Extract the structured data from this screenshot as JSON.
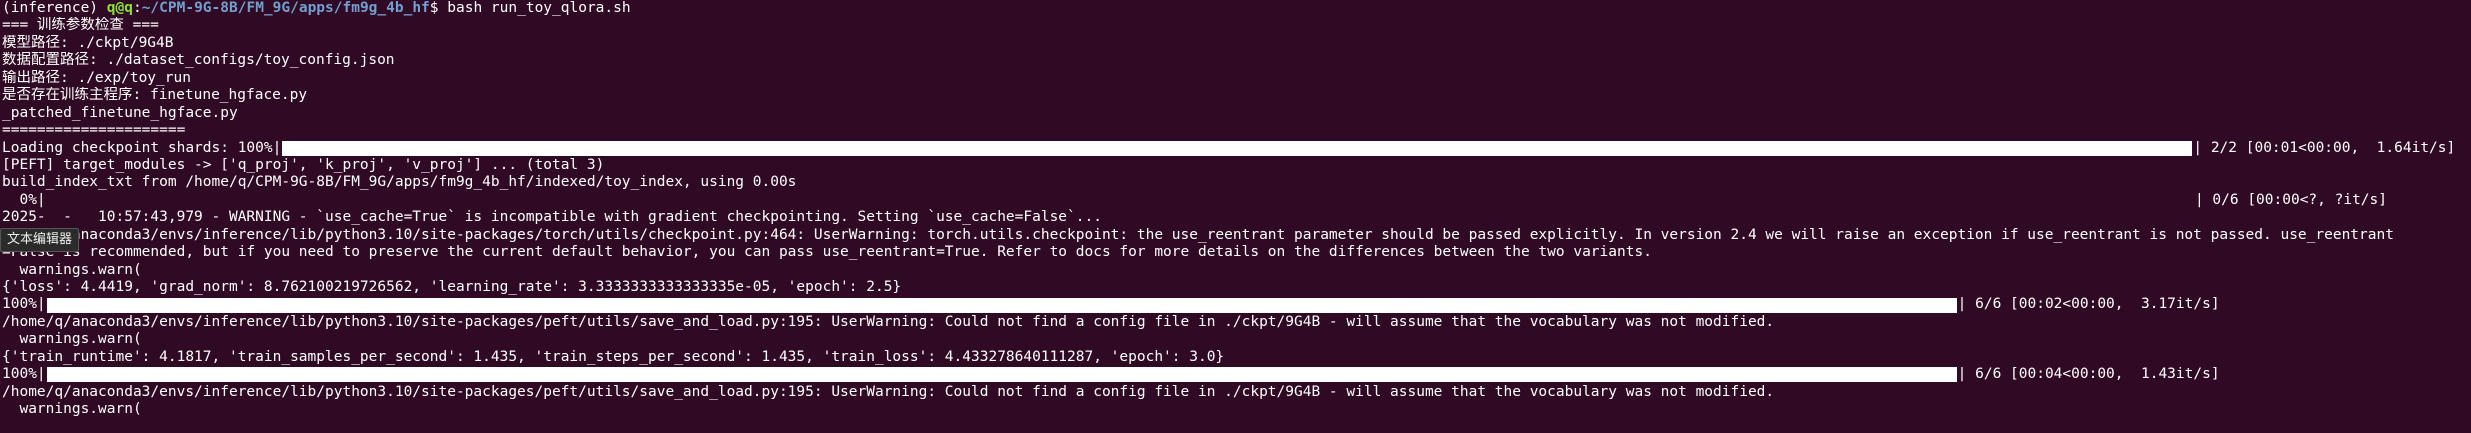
{
  "prompt": {
    "env": "(inference) ",
    "user": "q@q",
    "sep": ":",
    "path": "~/CPM-9G-8B/FM_9G/apps/fm9g_4b_hf",
    "symbol": "$ ",
    "command": "bash run_toy_qlora.sh"
  },
  "lines": {
    "l02": "=== 训练参数检查 ===",
    "l03": "模型路径: ./ckpt/9G4B",
    "l04": "数据配置路径: ./dataset_configs/toy_config.json",
    "l05": "输出路径: ./exp/toy_run",
    "l06": "是否存在训练主程序: finetune_hgface.py",
    "l07": "_patched_finetune_hgface.py",
    "l08": "=====================",
    "l10": "[PEFT] target_modules -> ['q_proj', 'k_proj', 'v_proj'] ... (total 3)",
    "l11": "build_index_txt from /home/q/CPM-9G-8B/FM_9G/apps/fm9g_4b_hf/indexed/toy_index, using 0.00s",
    "l13": "2025-  -   10:57:43,979 - WARNING - `use_cache=True` is incompatible with gradient checkpointing. Setting `use_cache=False`...",
    "l14": "/home/q/anaconda3/envs/inference/lib/python3.10/site-packages/torch/utils/checkpoint.py:464: UserWarning: torch.utils.checkpoint: the use_reentrant parameter should be passed explicitly. In version 2.4 we will raise an exception if use_reentrant is not passed. use_reentrant",
    "l15": "=False is recommended, but if you need to preserve the current default behavior, you can pass use_reentrant=True. Refer to docs for more details on the differences between the two variants.",
    "l16": "  warnings.warn(",
    "l17": "{'loss': 4.4419, 'grad_norm': 8.762100219726562, 'learning_rate': 3.3333333333333335e-05, 'epoch': 2.5}",
    "l19": "/home/q/anaconda3/envs/inference/lib/python3.10/site-packages/peft/utils/save_and_load.py:195: UserWarning: Could not find a config file in ./ckpt/9G4B - will assume that the vocabulary was not modified.",
    "l20": "  warnings.warn(",
    "l21": "{'train_runtime': 4.1817, 'train_samples_per_second': 1.435, 'train_steps_per_second': 1.435, 'train_loss': 4.433278640111287, 'epoch': 3.0}",
    "l23": "/home/q/anaconda3/envs/inference/lib/python3.10/site-packages/peft/utils/save_and_load.py:195: UserWarning: Could not find a config file in ./ckpt/9G4B - will assume that the vocabulary was not modified.",
    "l24": "  warnings.warn("
  },
  "progress": {
    "p1": {
      "prefix": "Loading checkpoint shards: 100%|",
      "suffix": "| 2/2 [00:01<00:00,  1.64it/s]",
      "fraction": 1.0
    },
    "p2": {
      "prefix": "  0%|",
      "suffix": "| 0/6 [00:00<?, ?it/s]",
      "fraction": 0.0
    },
    "p3": {
      "prefix": "100%|",
      "suffix": "| 6/6 [00:02<00:00,  3.17it/s]",
      "fraction": 1.0
    },
    "p4": {
      "prefix": "100%|",
      "suffix": "| 6/6 [00:04<00:00,  1.43it/s]",
      "fraction": 1.0
    }
  },
  "tooltip": {
    "label": "文本编辑器"
  }
}
